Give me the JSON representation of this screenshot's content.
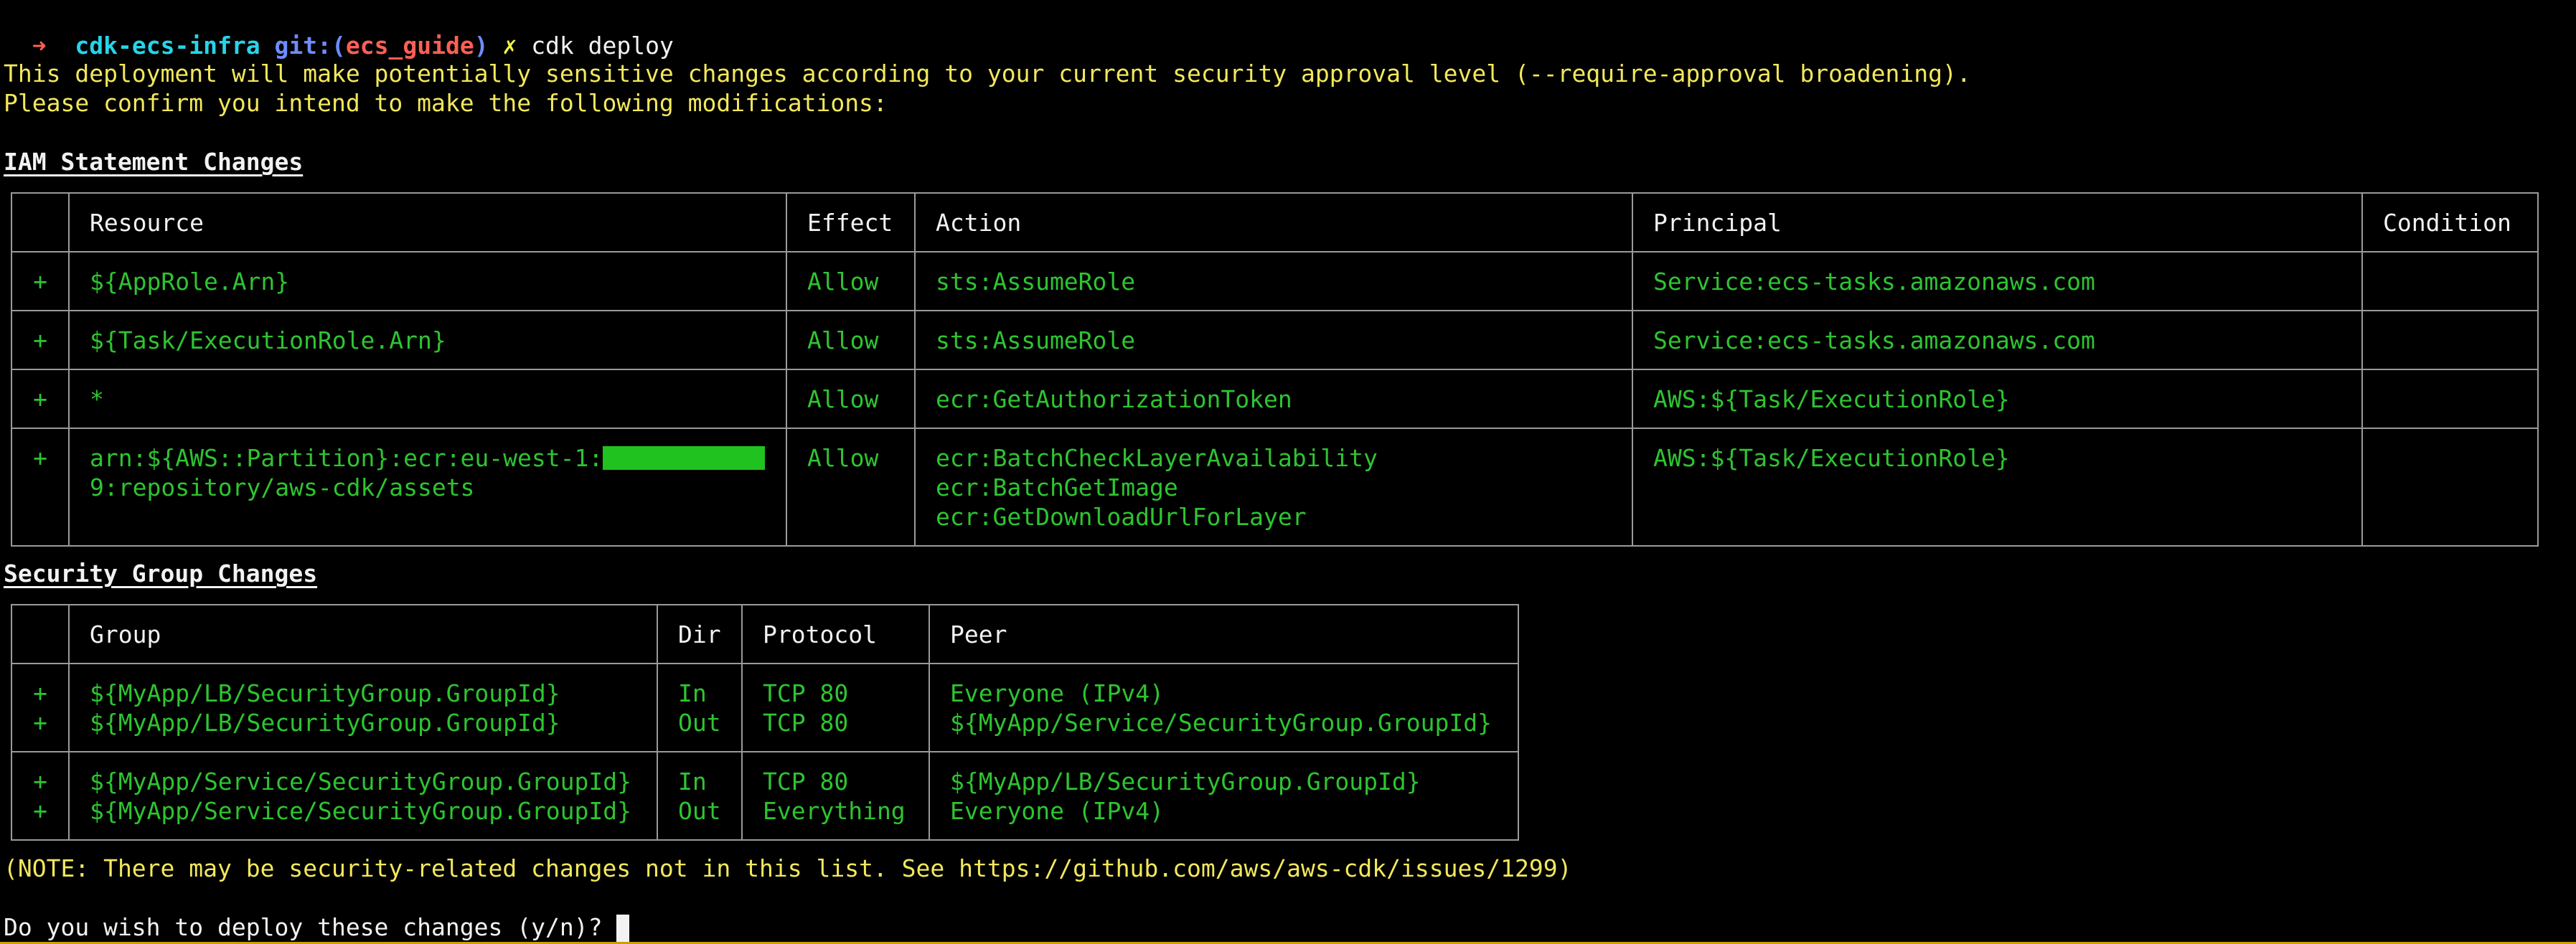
{
  "prompt": {
    "arrow": "➜",
    "dir": "cdk-ecs-infra",
    "git_label": "git:(",
    "branch": "ecs_guide",
    "git_close": ")",
    "dirty": "✗",
    "command": "cdk deploy"
  },
  "warning": {
    "line1": "This deployment will make potentially sensitive changes according to your current security approval level (--require-approval broadening).",
    "line2": "Please confirm you intend to make the following modifications:"
  },
  "iam": {
    "heading": "IAM Statement Changes",
    "headers": [
      "",
      "Resource",
      "Effect",
      "Action",
      "Principal",
      "Condition"
    ],
    "rows": [
      {
        "sign": "+",
        "resource": "${AppRole.Arn}",
        "effect": "Allow",
        "action": "sts:AssumeRole",
        "principal": "Service:ecs-tasks.amazonaws.com",
        "condition": ""
      },
      {
        "sign": "+",
        "resource": "${Task/ExecutionRole.Arn}",
        "effect": "Allow",
        "action": "sts:AssumeRole",
        "principal": "Service:ecs-tasks.amazonaws.com",
        "condition": ""
      },
      {
        "sign": "+",
        "resource": "*",
        "effect": "Allow",
        "action": "ecr:GetAuthorizationToken",
        "principal": "AWS:${Task/ExecutionRole}",
        "condition": ""
      },
      {
        "sign": "+",
        "resource_line1": "arn:${AWS::Partition}:ecr:eu-west-1:",
        "resource_line2": "9:repository/aws-cdk/assets",
        "effect": "Allow",
        "action_line1": "ecr:BatchCheckLayerAvailability",
        "action_line2": "ecr:BatchGetImage",
        "action_line3": "ecr:GetDownloadUrlForLayer",
        "principal": "AWS:${Task/ExecutionRole}",
        "condition": ""
      }
    ]
  },
  "sg": {
    "heading": "Security Group Changes",
    "headers": [
      "",
      "Group",
      "Dir",
      "Protocol",
      "Peer"
    ],
    "rows": [
      {
        "sign1": "+",
        "sign2": "+",
        "group1": "${MyApp/LB/SecurityGroup.GroupId}",
        "group2": "${MyApp/LB/SecurityGroup.GroupId}",
        "dir1": "In",
        "dir2": "Out",
        "proto1": "TCP 80",
        "proto2": "TCP 80",
        "peer1": "Everyone (IPv4)",
        "peer2": "${MyApp/Service/SecurityGroup.GroupId}"
      },
      {
        "sign1": "+",
        "sign2": "+",
        "group1": "${MyApp/Service/SecurityGroup.GroupId}",
        "group2": "${MyApp/Service/SecurityGroup.GroupId}",
        "dir1": "In",
        "dir2": "Out",
        "proto1": "TCP 80",
        "proto2": "Everything",
        "peer1": "${MyApp/LB/SecurityGroup.GroupId}",
        "peer2": "Everyone (IPv4)"
      }
    ]
  },
  "note": "(NOTE: There may be security-related changes not in this list. See https://github.com/aws/aws-cdk/issues/1299)",
  "question": "Do you wish to deploy these changes (y/n)? ",
  "colors": {
    "background": "#000000",
    "green": "#2ec431",
    "yellow": "#f2e85c",
    "border": "#9a9a9a",
    "prompt_red": "#ff5f56",
    "prompt_cyan": "#27d4e8",
    "prompt_blue": "#6e8cff"
  }
}
